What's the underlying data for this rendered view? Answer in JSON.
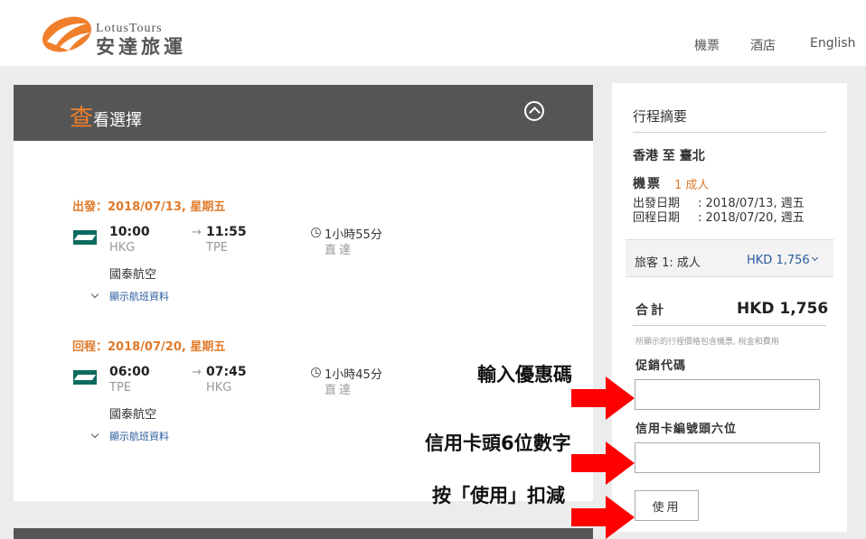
{
  "header": {
    "logo_en": "LotusTours",
    "logo_zh": "安達旅運",
    "nav": [
      "機票",
      "酒店",
      "English"
    ],
    "brand_color": "#f07f2c"
  },
  "left": {
    "title_first": "查",
    "title_rest": "看選擇",
    "legs": [
      {
        "title": "出發：2018/07/13, 星期五",
        "depart_time": "10:00",
        "depart_code": "HKG",
        "arrive_time": "11:55",
        "arrive_code": "TPE",
        "duration": "1小時55分",
        "stops": "直達",
        "airline": "國泰航空",
        "details": "顯示航班資料"
      },
      {
        "title": "回程：2018/07/20, 星期五",
        "depart_time": "06:00",
        "depart_code": "TPE",
        "arrive_time": "07:45",
        "arrive_code": "HKG",
        "duration": "1小時45分",
        "stops": "直達",
        "airline": "國泰航空",
        "details": "顯示航班資料"
      }
    ]
  },
  "summary": {
    "title": "行程摘要",
    "route": "香港 至 臺北",
    "ticket_label": "機票",
    "ticket_count": "1 成人",
    "depart_label": "出發日期",
    "depart_value": ": 2018/07/13, 週五",
    "return_label": "回程日期",
    "return_value": ": 2018/07/20, 週五",
    "traveler_label": "旅客 1: 成人",
    "traveler_price": "HKD 1,756",
    "total_label": "合計",
    "total_value": "HKD 1,756",
    "note": "所顯示的行程價格包含機票, 稅金和費用",
    "promo_label": "促銷代碼",
    "promo_value": "",
    "card_label": "信用卡編號頭六位",
    "card_value": "",
    "apply_label": "使用"
  },
  "annotations": {
    "promo": "輸入優惠碼",
    "card": "信用卡頭6位數字",
    "apply": "按「使用」扣減",
    "arrow_color": "#ff0000"
  }
}
